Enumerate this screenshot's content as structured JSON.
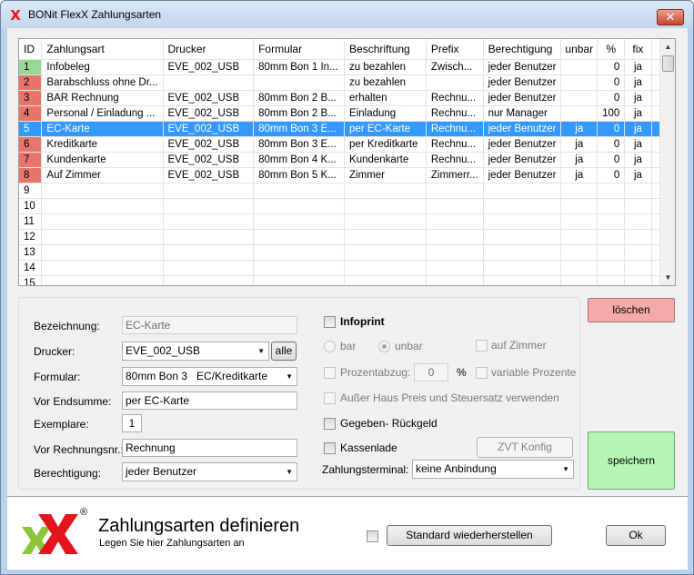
{
  "window": {
    "title": "BONit FlexX Zahlungsarten",
    "close_label": "✕"
  },
  "grid": {
    "columns": [
      "ID",
      "Zahlungsart",
      "Drucker",
      "Formular",
      "Beschriftung",
      "Prefix",
      "Berechtigung",
      "unbar",
      "%",
      "fix"
    ],
    "rows": [
      {
        "id": "1",
        "id_color": "#97d897",
        "name": "Infobeleg",
        "printer": "EVE_002_USB",
        "form": "80mm Bon 1  In...",
        "label": "zu bezahlen",
        "prefix": "Zwisch...",
        "permission": "jeder Benutzer",
        "unbar": "",
        "percent": "0",
        "fix": "ja"
      },
      {
        "id": "2",
        "id_color": "#e8756b",
        "name": "Barabschluss ohne Dr...",
        "printer": "",
        "form": "",
        "label": "zu bezahlen",
        "prefix": "",
        "permission": "jeder Benutzer",
        "unbar": "",
        "percent": "0",
        "fix": "ja"
      },
      {
        "id": "3",
        "id_color": "#e8756b",
        "name": "BAR Rechnung",
        "printer": "EVE_002_USB",
        "form": "80mm Bon 2  B...",
        "label": "erhalten",
        "prefix": "Rechnu...",
        "permission": "jeder Benutzer",
        "unbar": "",
        "percent": "0",
        "fix": "ja"
      },
      {
        "id": "4",
        "id_color": "#e8756b",
        "name": "Personal / Einladung ...",
        "printer": "EVE_002_USB",
        "form": "80mm Bon 2  B...",
        "label": "Einladung",
        "prefix": "Rechnu...",
        "permission": "nur Manager",
        "unbar": "",
        "percent": "100",
        "fix": "ja"
      },
      {
        "id": "5",
        "id_color": "#3399ff",
        "name": "EC-Karte",
        "printer": "EVE_002_USB",
        "form": "80mm Bon 3  E...",
        "label": "per EC-Karte",
        "prefix": "Rechnu...",
        "permission": "jeder Benutzer",
        "unbar": "ja",
        "percent": "0",
        "fix": "ja"
      },
      {
        "id": "6",
        "id_color": "#e8756b",
        "name": "Kreditkarte",
        "printer": "EVE_002_USB",
        "form": "80mm Bon 3  E...",
        "label": "per Kreditkarte",
        "prefix": "Rechnu...",
        "permission": "jeder Benutzer",
        "unbar": "ja",
        "percent": "0",
        "fix": "ja"
      },
      {
        "id": "7",
        "id_color": "#e8756b",
        "name": "Kundenkarte",
        "printer": "EVE_002_USB",
        "form": "80mm Bon 4  K...",
        "label": "Kundenkarte",
        "prefix": "Rechnu...",
        "permission": "jeder Benutzer",
        "unbar": "ja",
        "percent": "0",
        "fix": "ja"
      },
      {
        "id": "8",
        "id_color": "#e8756b",
        "name": "Auf Zimmer",
        "printer": "EVE_002_USB",
        "form": "80mm Bon 5  K...",
        "label": "Zimmer",
        "prefix": "Zimmerr...",
        "permission": "jeder Benutzer",
        "unbar": "ja",
        "percent": "0",
        "fix": "ja"
      },
      {
        "id": "9"
      },
      {
        "id": "10"
      },
      {
        "id": "11"
      },
      {
        "id": "12"
      },
      {
        "id": "13"
      },
      {
        "id": "14"
      },
      {
        "id": "15"
      }
    ],
    "selected_index": 4
  },
  "form": {
    "bezeichnung_label": "Bezeichnung:",
    "bezeichnung_value": "EC-Karte",
    "drucker_label": "Drucker:",
    "drucker_value": "EVE_002_USB",
    "alle_label": "alle",
    "formular_label": "Formular:",
    "formular_value": "80mm Bon 3   EC/Kreditkarte",
    "vor_endsumme_label": "Vor Endsumme:",
    "vor_endsumme_value": "per EC-Karte",
    "exemplare_label": "Exemplare:",
    "exemplare_value": "1",
    "vor_rechnungsnr_label": "Vor Rechnungsnr.:",
    "vor_rechnungsnr_value": "Rechnung",
    "berechtigung_label": "Berechtigung:",
    "berechtigung_value": "jeder Benutzer",
    "infoprint_label": "Infoprint",
    "bar_label": "bar",
    "unbar_label": "unbar",
    "auf_zimmer_label": "auf Zimmer",
    "prozentabzug_label": "Prozentabzug:",
    "prozentabzug_value": "0",
    "percent_sign": "%",
    "variable_prozente_label": "variable Prozente",
    "ausser_haus_label": "Außer Haus Preis und Steuersatz verwenden",
    "gegeben_label": "Gegeben- Rückgeld",
    "kassenlade_label": "Kassenlade",
    "zvt_label": "ZVT Konfig",
    "zahlungsterminal_label": "Zahlungsterminal:",
    "zahlungsterminal_value": "keine Anbindung"
  },
  "buttons": {
    "delete_label": "löschen",
    "save_label": "speichern",
    "restore_label": "Standard wiederherstellen",
    "ok_label": "Ok"
  },
  "footer": {
    "title": "Zahlungsarten definieren",
    "subtitle": "Legen Sie hier Zahlungsarten an",
    "logo_text": "X",
    "registered": "®"
  },
  "colors": {
    "selection": "#3399ff",
    "id_green": "#97d897",
    "id_red": "#e8756b",
    "delete_bg": "#f6a9a9",
    "save_bg": "#b3f7b3"
  }
}
